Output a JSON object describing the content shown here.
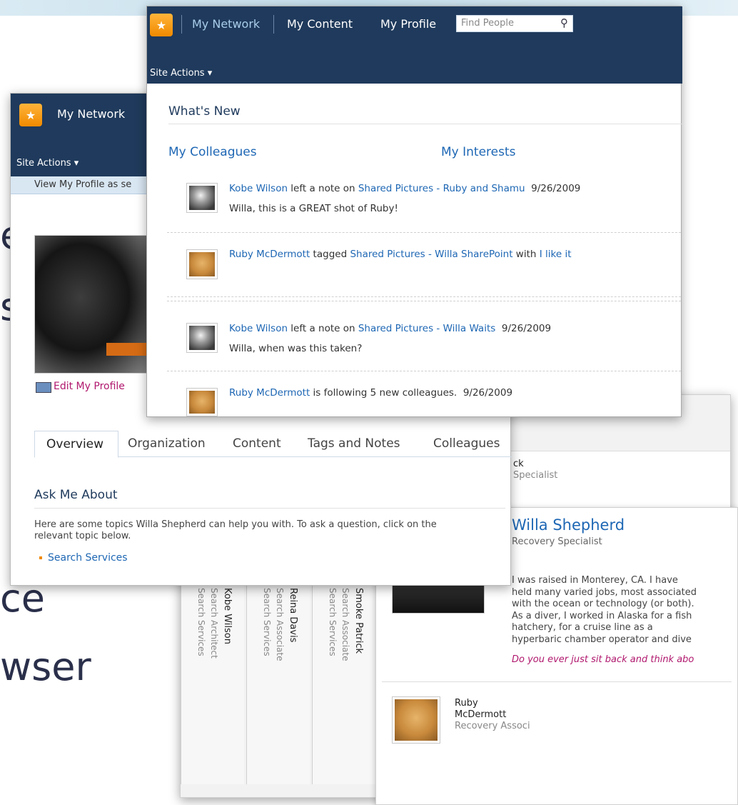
{
  "slide": {
    "fragments": [
      "e",
      "s",
      "ce",
      "wser"
    ]
  },
  "front": {
    "nav": {
      "tab1": "My Network",
      "tab2": "My Content",
      "tab3": "My Profile",
      "search_placeholder": "Find People"
    },
    "site_actions": "Site Actions ▾",
    "whats_new": "What's New",
    "sections": {
      "colleagues": "My Colleagues",
      "interests": "My Interests"
    },
    "feed": [
      {
        "who": "Kobe Wilson",
        "verb": " left a note on ",
        "target": "Shared Pictures - Ruby and Shamu",
        "date": "9/26/2009",
        "note": "Willa, this is a GREAT shot of Ruby!"
      },
      {
        "who": "Ruby McDermott",
        "verb": " tagged ",
        "target": "Shared Pictures - Willa SharePoint",
        "with": " with ",
        "tag": "I like it"
      },
      {
        "who": "Kobe Wilson",
        "verb": " left a note on ",
        "target": "Shared Pictures - Willa Waits",
        "date": "9/26/2009",
        "note": "Willa, when was this taken?"
      },
      {
        "who": "Ruby McDermott",
        "verb": " is following 5 new colleagues.",
        "date": "9/26/2009"
      }
    ]
  },
  "profile": {
    "nav_title": "My Network",
    "site_actions": "Site Actions ▾",
    "view_as": "View My Profile as se",
    "edit": "Edit My Profile",
    "tabs": [
      "Overview",
      "Organization",
      "Content",
      "Tags and Notes",
      "Colleagues"
    ],
    "ask_title": "Ask Me About",
    "ask_desc_1": "Here are some topics Willa Shepherd can help you with. To ask a question, click on the",
    "ask_desc_2": "relevant topic below.",
    "topic": "Search Services"
  },
  "org": {
    "people": [
      {
        "name": "Kobe Wilson",
        "title": "Search Architect",
        "dept": "Search Services"
      },
      {
        "name": "Reina Davis",
        "title": "Search Associate",
        "dept": "Search Services"
      },
      {
        "name": "Smoke Patrick",
        "title": "Search Associate",
        "dept": "Search Services"
      }
    ],
    "top_name_frag": "ck",
    "top_title_frag": "Specialist"
  },
  "card": {
    "name": "Willa Shepherd",
    "title": "Recovery Specialist",
    "bio": [
      "I was raised in Monterey, CA. I have",
      "held many varied jobs, most associated",
      "with the ocean or technology (or both).",
      "As a diver, I worked in Alaska for a fish",
      "hatchery, for a cruise line as a",
      "hyperbaric chamber operator and dive"
    ],
    "quote": "Do you ever just sit back and think abo",
    "person2": {
      "first": "Ruby",
      "last": "McDermott",
      "title": "Recovery Associ"
    }
  }
}
